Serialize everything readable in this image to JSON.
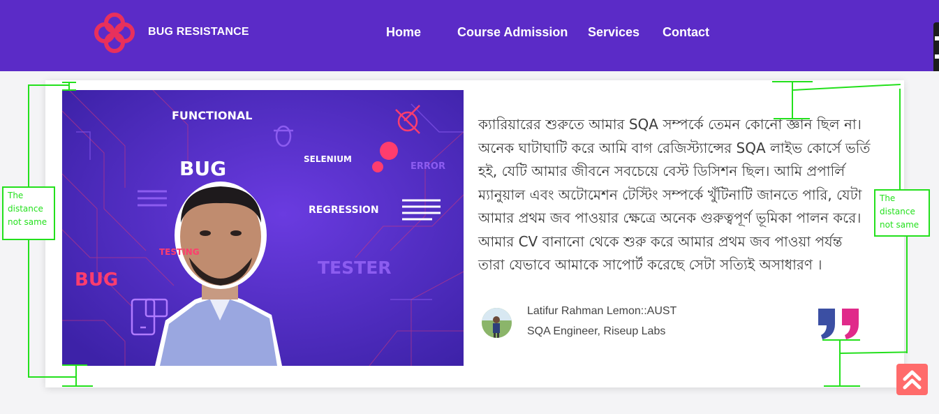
{
  "header": {
    "brand": "BUG RESISTANCE",
    "nav": [
      {
        "label": "Home"
      },
      {
        "label": "Course Admission"
      },
      {
        "label": "Services"
      },
      {
        "label": "Contact"
      }
    ]
  },
  "banner": {
    "words": [
      "FUNCTIONAL",
      "BUG",
      "SELENIUM",
      "ERROR",
      "REGRESSION",
      "TESTING",
      "TESTER",
      "BUG"
    ]
  },
  "testimonial": {
    "text": "ক্যারিয়ারের শুরুতে আমার SQA সম্পর্কে তেমন কোনো জ্ঞান ছিল না। অনেক ঘাটাঘাটি করে আমি বাগ রেজিস্ট্যান্সের SQA লাইভ কোর্সে ভর্তি হই, যেটি আমার জীবনে সবচেয়ে বেস্ট ডিসিশন ছিল। আমি প্রপার্লি ম্যানুয়াল এবং অটোমেশন টেস্টিং সম্পর্কে খুঁটিনাটি জানতে পারি, যেটা আমার প্রথম জব পাওয়ার ক্ষেত্রে অনেক গুরুত্বপূর্ণ ভূমিকা পালন করে। আমার CV বানানো থেকে শুরু করে আমার প্রথম জব পাওয়া পর্যন্ত তারা যেভাবে আমাকে সাপোর্ট করেছে সেটা সত্যিই অসাধারণ ।",
    "author_name": "Latifur Rahman Lemon::AUST",
    "author_role": "SQA Engineer, Riseup Labs"
  },
  "annotations": {
    "left_note": "The distance not same",
    "right_note": "The distance not same"
  },
  "colors": {
    "navbar": "#5b2bc7",
    "accent": "#e8305c",
    "annotation": "#23e01c",
    "scroll_button": "#ff6b6b"
  },
  "icons": [
    "logo-mark-icon",
    "quote-icon",
    "double-chevron-up-icon"
  ]
}
